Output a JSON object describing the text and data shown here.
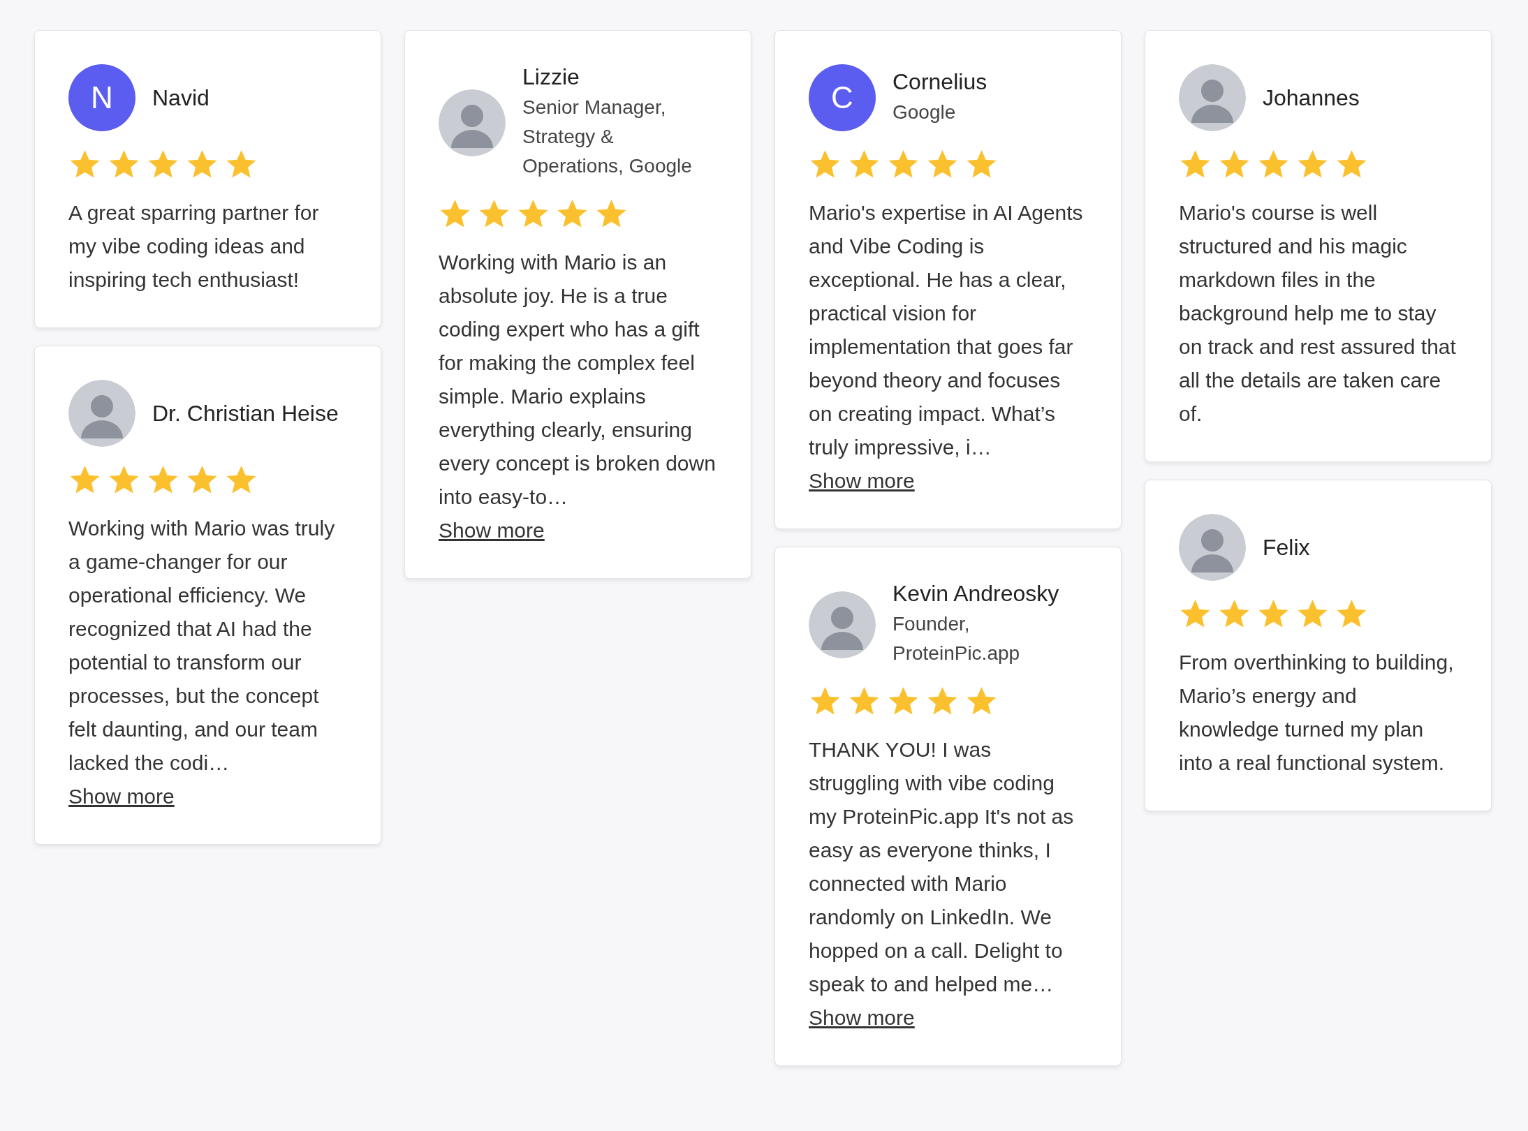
{
  "columns": [
    {
      "cards": [
        {
          "avatar": {
            "kind": "letter",
            "letter": "N"
          },
          "name": "Navid",
          "stars": 5,
          "text": "A great sparring partner for my vibe coding ideas and inspiring tech enthusiast!"
        },
        {
          "avatar": {
            "kind": "photo"
          },
          "name": "Dr. Christian Heise",
          "stars": 5,
          "text": "Working with Mario was truly a game-changer for our operational efficiency. We recognized that AI had the potential to transform our processes, but the concept felt daunting, and our team lacked the codi…",
          "show_more": "Show more"
        }
      ]
    },
    {
      "cards": [
        {
          "avatar": {
            "kind": "photo"
          },
          "name": "Lizzie",
          "subtitle": "Senior Manager, Strategy & Operations, Google",
          "stars": 5,
          "text": "Working with Mario is an absolute joy. He is a true coding expert who has a gift for making the complex feel simple. Mario explains everything clearly, ensuring every concept is broken down into easy-to…",
          "show_more": "Show more"
        }
      ]
    },
    {
      "cards": [
        {
          "avatar": {
            "kind": "letter",
            "letter": "C"
          },
          "name": "Cornelius",
          "subtitle": "Google",
          "stars": 5,
          "text": "Mario's expertise in AI Agents and Vibe Coding is exceptional. He has a clear, practical vision for implementation that goes far beyond theory and focuses on creating impact. What’s truly impressive, i…",
          "show_more": "Show more"
        },
        {
          "avatar": {
            "kind": "photo"
          },
          "name": "Kevin Andreosky",
          "subtitle": "Founder, ProteinPic.app",
          "stars": 5,
          "text": "THANK YOU! I was struggling with vibe coding my ProteinPic.app It's not as easy as everyone thinks, I connected with Mario randomly on LinkedIn. We hopped on a call. Delight to speak to and helped me…",
          "show_more": "Show more"
        }
      ]
    },
    {
      "cards": [
        {
          "avatar": {
            "kind": "photo"
          },
          "name": "Johannes",
          "stars": 5,
          "text": "Mario's course is well structured and his magic markdown files in the background help me to stay on track and rest assured that all the details are taken care of."
        },
        {
          "avatar": {
            "kind": "photo"
          },
          "name": "Felix",
          "stars": 5,
          "text": "From overthinking to building, Mario’s energy and knowledge turned my plan into a real functional system."
        }
      ]
    }
  ]
}
